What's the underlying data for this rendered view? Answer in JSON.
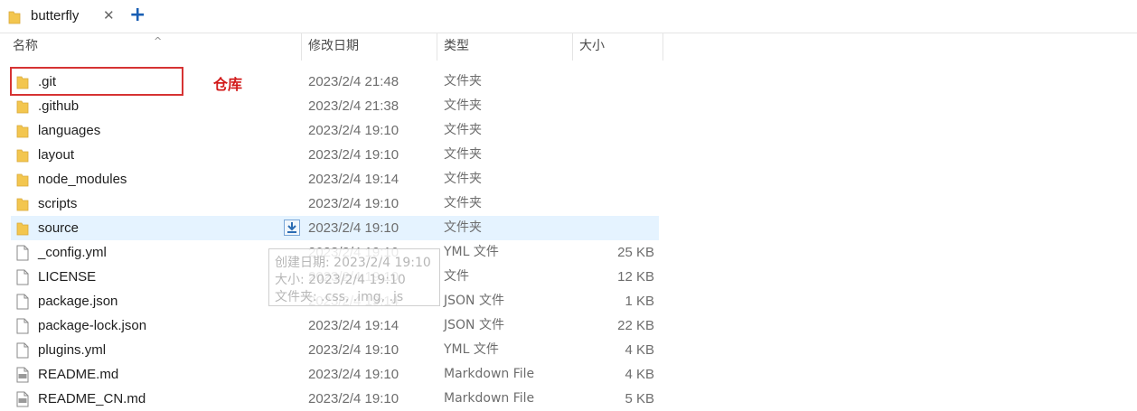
{
  "window": {
    "tab_title": "butterfly",
    "tab_close": "✕",
    "new_tab": "+"
  },
  "columns": {
    "name": "名称",
    "modified": "修改日期",
    "type": "类型",
    "size": "大小",
    "sort_indicator": "^"
  },
  "files": [
    {
      "name": ".git",
      "date": "2023/2/4 21:48",
      "type": "文件夹",
      "size": "",
      "icon": "folder-icon"
    },
    {
      "name": ".github",
      "date": "2023/2/4 21:38",
      "type": "文件夹",
      "size": "",
      "icon": "folder-icon"
    },
    {
      "name": "languages",
      "date": "2023/2/4 19:10",
      "type": "文件夹",
      "size": "",
      "icon": "folder-icon"
    },
    {
      "name": "layout",
      "date": "2023/2/4 19:10",
      "type": "文件夹",
      "size": "",
      "icon": "folder-icon"
    },
    {
      "name": "node_modules",
      "date": "2023/2/4 19:14",
      "type": "文件夹",
      "size": "",
      "icon": "folder-icon"
    },
    {
      "name": "scripts",
      "date": "2023/2/4 19:10",
      "type": "文件夹",
      "size": "",
      "icon": "folder-icon"
    },
    {
      "name": "source",
      "date": "2023/2/4 19:10",
      "type": "文件夹",
      "size": "",
      "icon": "folder-icon"
    },
    {
      "name": "_config.yml",
      "date": "2023/2/4 19:10",
      "type": "YML 文件",
      "size": "25 KB",
      "icon": "file-icon"
    },
    {
      "name": "LICENSE",
      "date": "2023/2/4 19:10",
      "type": "文件",
      "size": "12 KB",
      "icon": "file-icon"
    },
    {
      "name": "package.json",
      "date": "2023/2/4 19:14",
      "type": "JSON 文件",
      "size": "1 KB",
      "icon": "file-icon"
    },
    {
      "name": "package-lock.json",
      "date": "2023/2/4 19:14",
      "type": "JSON 文件",
      "size": "22 KB",
      "icon": "file-icon"
    },
    {
      "name": "plugins.yml",
      "date": "2023/2/4 19:10",
      "type": "YML 文件",
      "size": "4 KB",
      "icon": "file-icon"
    },
    {
      "name": "README.md",
      "date": "2023/2/4 19:10",
      "type": "Markdown File",
      "size": "4 KB",
      "icon": "markdown-file-icon"
    },
    {
      "name": "README_CN.md",
      "date": "2023/2/4 19:10",
      "type": "Markdown File",
      "size": "5 KB",
      "icon": "markdown-file-icon"
    }
  ],
  "annotation": {
    "label": "仓库",
    "color": "#d21a1a"
  },
  "tooltip": {
    "line1": "创建日期: 2023/2/4 19:10",
    "line2": "大小: 2023/2/4 19:10",
    "line3": "文件夹: .css, .img, .js"
  },
  "colors": {
    "hover_row": "#e5f3ff",
    "folder": "#f3c64f",
    "accent": "#1a5fb4"
  }
}
